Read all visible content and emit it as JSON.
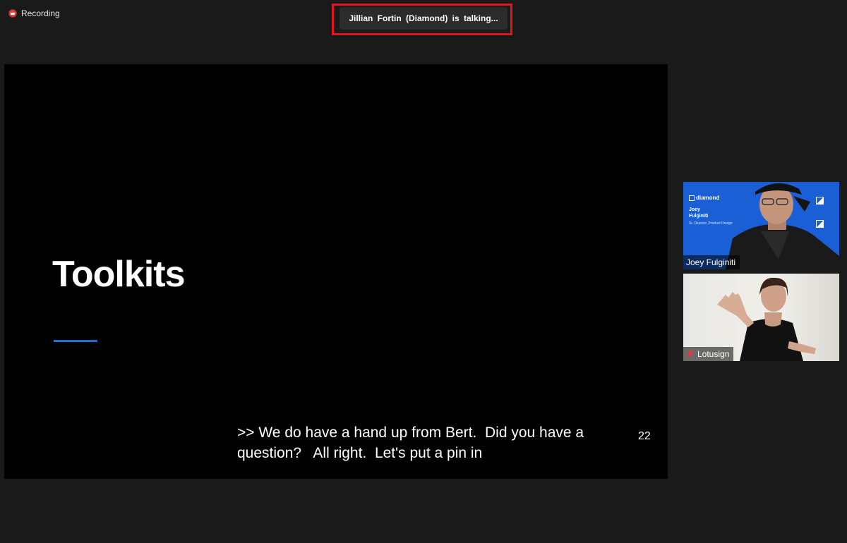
{
  "recording": {
    "label": "Recording"
  },
  "talking_indicator": {
    "text": "Jillian Fortin (Diamond) is talking..."
  },
  "shared_screen": {
    "slide_title": "Toolkits",
    "page_number": "22",
    "caption": ">> We do have a hand up from Bert.  Did you have a\nquestion?   All right.  Let's put a pin in"
  },
  "participants": [
    {
      "name": "Joey Fulginiti",
      "background": {
        "brand": "diamond",
        "name_line1": "Joey",
        "name_line2": "Fulginiti",
        "role": "Sr. Director, Product Design"
      }
    },
    {
      "name": "Lotusign",
      "muted": true
    }
  ],
  "colors": {
    "highlight_border": "#e0151d",
    "recording_dot": "#e0483d",
    "slide_accent": "#1f6fd1",
    "joey_background": "#1b5fd6"
  }
}
